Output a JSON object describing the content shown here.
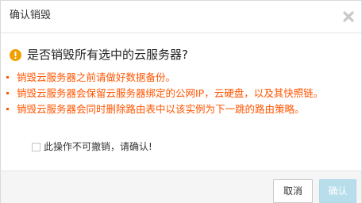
{
  "dialog": {
    "title": "确认销毁",
    "close_icon": "close-icon",
    "question": "是否销毁所有选中的云服务器?",
    "question_icon": "warning-icon",
    "warnings": [
      "销毁云服务器之前请做好数据备份。",
      "销毁云服务器会保留云服务器绑定的公网IP，云硬盘，以及其快照链。",
      "销毁云服务器会同时删除路由表中以该实例为下一跳的路由策略。"
    ],
    "confirm_checkbox": {
      "checked": false,
      "label": "此操作不可撤销，请确认!"
    },
    "buttons": {
      "cancel_label": "取消",
      "ok_label": "确认",
      "ok_disabled": true
    }
  },
  "colors": {
    "warning_text": "#ff5500",
    "warning_icon": "#f0a000",
    "ok_button_disabled": "#b8deec"
  }
}
